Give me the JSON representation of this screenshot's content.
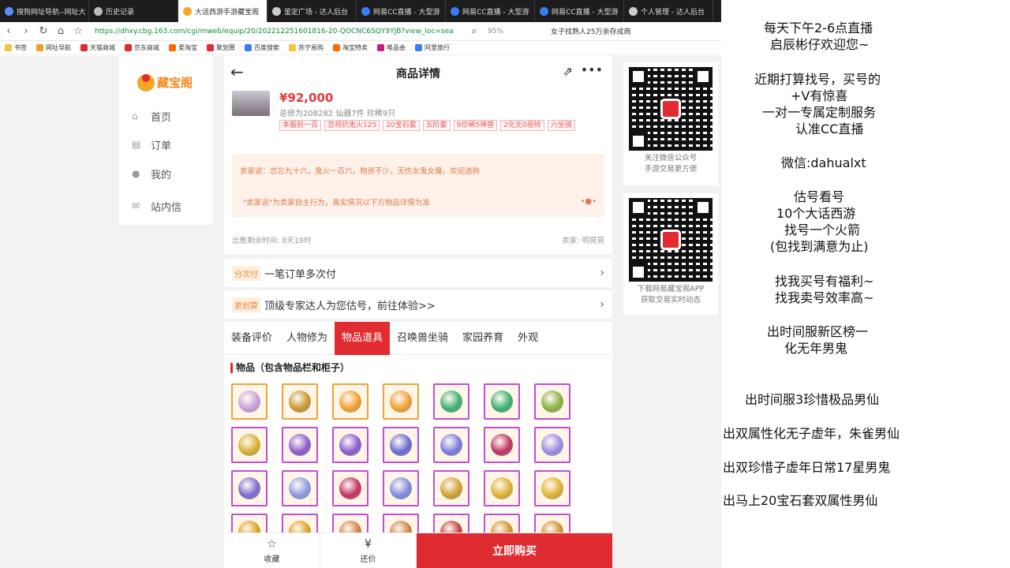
{
  "browser": {
    "tabs": [
      {
        "label": "搜狗网址导航--网址大",
        "color": "#5a8cff"
      },
      {
        "label": "历史记录",
        "color": "#bbbbbb"
      },
      {
        "label": "大话西游手游藏宝阁",
        "color": "#f5a623"
      },
      {
        "label": "鉴定广场 - 达人后台",
        "color": "#cccccc"
      },
      {
        "label": "网易CC直播 - 大型游",
        "color": "#3a7cf5"
      },
      {
        "label": "网易CC直播 - 大型游",
        "color": "#3a7cf5"
      },
      {
        "label": "网易CC直播 - 大型游",
        "color": "#3a7cf5"
      },
      {
        "label": "个人管理 - 达人后台",
        "color": "#cccccc"
      }
    ],
    "active_tab_index": 2,
    "url": "https://dhxy.cbg.163.com/cgi/mweb/equip/20/202212251601816-20-QOCNC6SQY9YJB?view_loc=sea",
    "zoom": "95%",
    "search_text": "女子找熟人25万余存成商",
    "bookmarks": [
      {
        "label": "书签",
        "color": "#f5c542"
      },
      {
        "label": "网址导航",
        "color": "#f59a23"
      },
      {
        "label": "天猫商城",
        "color": "#e02b30"
      },
      {
        "label": "京东商城",
        "color": "#e02b30"
      },
      {
        "label": "爱淘宝",
        "color": "#ff6a00"
      },
      {
        "label": "聚划算",
        "color": "#e02b30"
      },
      {
        "label": "百度搜索",
        "color": "#3a7cf5"
      },
      {
        "label": "苏宁易购",
        "color": "#f5c542"
      },
      {
        "label": "淘宝特卖",
        "color": "#ff6a00"
      },
      {
        "label": "唯品会",
        "color": "#c41d7f"
      },
      {
        "label": "阿里旅行",
        "color": "#3a7cf5"
      }
    ]
  },
  "sidebar": {
    "logo": "藏宝阁",
    "items": [
      {
        "label": "首页",
        "icon": "home-icon"
      },
      {
        "label": "订单",
        "icon": "order-icon"
      },
      {
        "label": "我的",
        "icon": "user-icon"
      },
      {
        "label": "站内信",
        "icon": "mail-icon"
      }
    ]
  },
  "detail": {
    "title": "商品详情",
    "price": "¥92,000",
    "stats": "总修为208282  仙器7件  珍稀9只",
    "tags": [
      "本服前一百",
      "忽视抗鬼火125",
      "20宝石套",
      "五阶套",
      "9珍稀5神兽",
      "2化无0祖转",
      "六坐骑"
    ],
    "seller_says": "卖家说：忽忘九十六，鬼火一百六，物资不少，无伤女鬼女魔，欢迎选购",
    "disclaimer": "\"卖家说\"为卖家自主行为，真实情况以下方物品详情为准",
    "time_left": "出售剩余时间: 8天19时",
    "seller": "卖家: 明晃晃"
  },
  "bars": [
    {
      "badge": "分次付",
      "text": "一笔订单多次付"
    },
    {
      "badge": "更划算",
      "text": "顶级专家达人为您估号，前往体验>>"
    }
  ],
  "product_tabs": [
    "装备评价",
    "人物修为",
    "物品道具",
    "召唤兽坐骑",
    "家园养育",
    "外观"
  ],
  "active_product_tab": 2,
  "items_section": {
    "title": "物品（包含物品栏和柜子）",
    "items": [
      {
        "name": "item",
        "color": "#c8a0d8",
        "frame": "gold"
      },
      {
        "name": "item",
        "color": "#c9962e",
        "frame": "gold"
      },
      {
        "name": "item",
        "color": "#f0a030",
        "frame": "gold"
      },
      {
        "name": "item",
        "color": "#f0a030",
        "frame": "gold"
      },
      {
        "name": "item",
        "color": "#3ab070",
        "frame": "purple"
      },
      {
        "name": "item",
        "color": "#3ab070",
        "frame": "purple"
      },
      {
        "name": "item",
        "color": "#8ab040",
        "frame": "purple"
      },
      {
        "name": "item",
        "color": "#d8b030",
        "frame": "purple"
      },
      {
        "name": "item",
        "color": "#8a5ad0",
        "frame": "purple"
      },
      {
        "name": "item",
        "color": "#8a5ad0",
        "frame": "purple"
      },
      {
        "name": "item",
        "color": "#6a6ad0",
        "frame": "purple"
      },
      {
        "name": "item",
        "color": "#7a7ae0",
        "frame": "purple"
      },
      {
        "name": "item",
        "color": "#c03060",
        "frame": "purple"
      },
      {
        "name": "item",
        "color": "#9a8ae0",
        "frame": "purple"
      },
      {
        "name": "item",
        "color": "#7a6ad0",
        "frame": "purple"
      },
      {
        "name": "item",
        "color": "#8a9ae0",
        "frame": "purple"
      },
      {
        "name": "item",
        "color": "#c03060",
        "frame": "purple"
      },
      {
        "name": "item",
        "color": "#7a8ae0",
        "frame": "purple"
      },
      {
        "name": "item",
        "color": "#d0a030",
        "frame": "purple"
      },
      {
        "name": "item",
        "color": "#e0b030",
        "frame": "purple"
      },
      {
        "name": "item",
        "color": "#e0b030",
        "frame": "purple"
      },
      {
        "name": "item",
        "color": "#e0a020",
        "frame": "purple"
      },
      {
        "name": "item",
        "color": "#e0a020",
        "frame": "purple"
      },
      {
        "name": "item",
        "color": "#d08040",
        "frame": "purple"
      },
      {
        "name": "item",
        "color": "#d08040",
        "frame": "purple"
      },
      {
        "name": "item",
        "color": "#c04040",
        "frame": "purple"
      },
      {
        "name": "item",
        "color": "#d09030",
        "frame": "purple"
      },
      {
        "name": "item",
        "color": "#d09030",
        "frame": "purple"
      }
    ]
  },
  "footer": {
    "favorite": "收藏",
    "bargain": "还价",
    "buy": "立即购买"
  },
  "qr1": {
    "caption1": "关注微信公众号",
    "caption2": "手游交易更方便"
  },
  "qr2": {
    "caption1": "下载网易藏宝阁APP",
    "caption2": "获取交易实时动态"
  },
  "overlay": {
    "lines": [
      "每天下午2-6点直播",
      "启辰彬仔欢迎您~",
      "近期打算找号，买号的",
      "+V有惊喜",
      "一对一专属定制服务",
      "认准CC直播",
      "微信:dahualxt",
      "估号看号",
      "10个大话西游",
      "找号一个火箭",
      "(包找到满意为止)",
      "找我买号有福利~",
      "找我卖号效率高~",
      "出时间服新区榜一",
      "化无年男鬼",
      "出时间服3珍惜极品男仙",
      "出双属性化无子虚年，朱雀男仙",
      "出双珍惜子虚年日常17星男鬼",
      "出马上20宝石套双属性男仙"
    ]
  }
}
